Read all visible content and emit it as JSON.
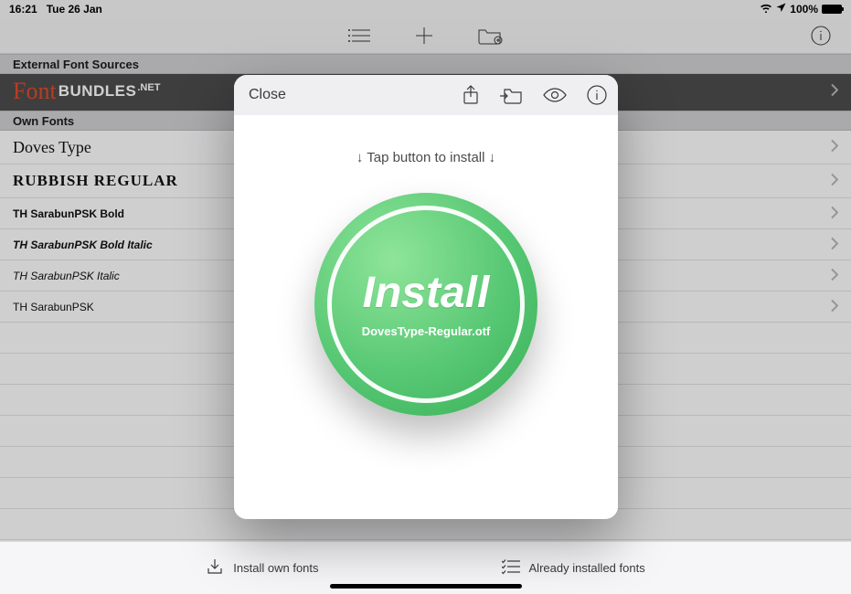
{
  "status": {
    "time": "16:21",
    "date": "Tue 26 Jan",
    "battery_pct": "100%"
  },
  "sections": {
    "external_header": "External Font Sources",
    "brand_script": "Font",
    "brand_rest": "BUNDLES",
    "brand_net": ".NET",
    "own_header": "Own Fonts"
  },
  "fonts": [
    {
      "label": "Doves Type",
      "cls": "font-doves"
    },
    {
      "label": "Rubbish Regular",
      "cls": "font-rubbish"
    },
    {
      "label": "TH SarabunPSK Bold",
      "cls": "font-sans bold"
    },
    {
      "label": "TH SarabunPSK Bold Italic",
      "cls": "font-sans bold ital"
    },
    {
      "label": "TH SarabunPSK Italic",
      "cls": "font-sans ital"
    },
    {
      "label": "TH SarabunPSK",
      "cls": "font-sans"
    }
  ],
  "bottom": {
    "install_own": "Install own fonts",
    "already": "Already installed fonts"
  },
  "modal": {
    "close": "Close",
    "hint": "↓ Tap button to install ↓",
    "install_word": "Install",
    "filename": "DovesType-Regular.otf"
  }
}
